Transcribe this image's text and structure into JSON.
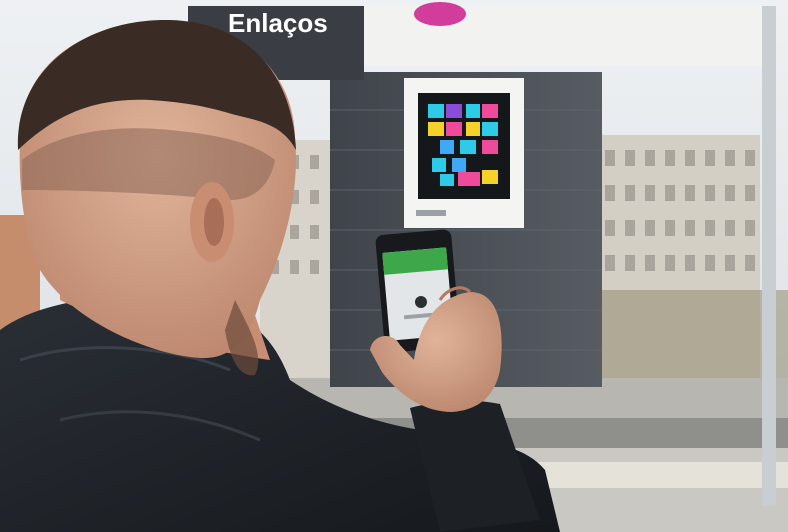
{
  "photo": {
    "sign_text": "Enlaços",
    "colors": {
      "sky": "#e6eaee",
      "pillar": "#4a4f57",
      "building": "#d3cfc6",
      "jacket": "#1f2328",
      "skin": "#d8a88f",
      "hair": "#3a2c24",
      "code_panel": "#111417",
      "phone_green": "#3da84a"
    },
    "code_tiles": [
      "#2ecbe8",
      "#f04a9b",
      "#f6d229",
      "#3fa9f5",
      "#8a4dd8"
    ]
  }
}
